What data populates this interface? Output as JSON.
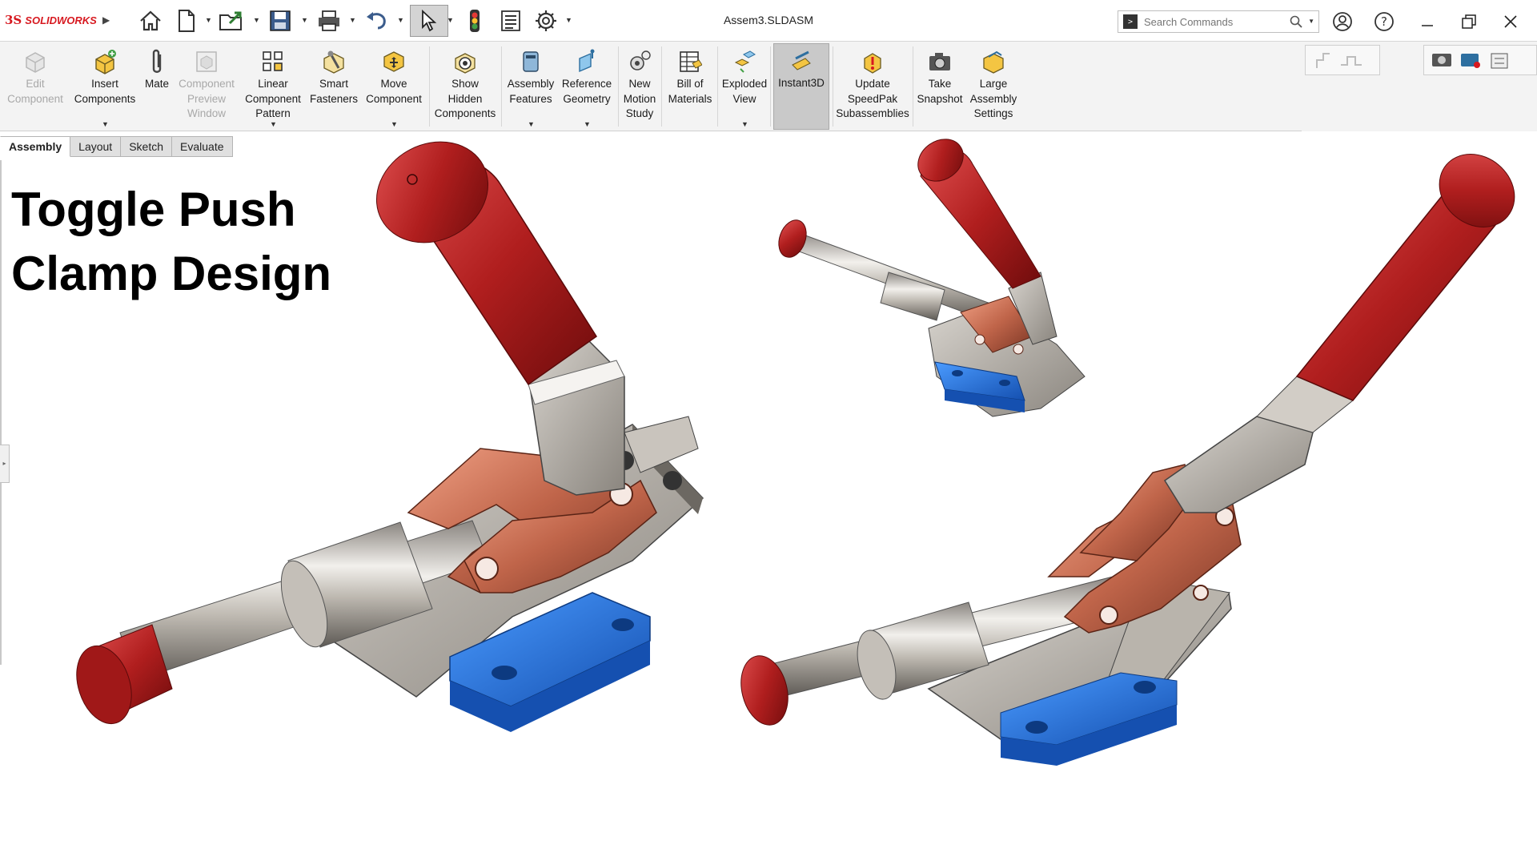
{
  "app": {
    "brand": "SOLIDWORKS",
    "brand_mark": "3S",
    "document_title": "Assem3.SLDASM"
  },
  "search": {
    "placeholder": "Search Commands"
  },
  "colors": {
    "brand_red": "#d71920",
    "handle_red": "#b01e1e",
    "link_copper": "#c0654a",
    "base_blue": "#1e6fd9",
    "steel": "#9c958c"
  },
  "quick_access": [
    "home-icon",
    "new-document-icon",
    "open-icon",
    "save-icon",
    "print-icon",
    "undo-icon",
    "select-icon",
    "rebuild-icon",
    "file-properties-icon",
    "options-icon"
  ],
  "window_buttons": [
    "account-icon",
    "help-icon",
    "minimize-icon",
    "restore-icon",
    "close-icon"
  ],
  "ribbon": {
    "edit_component": "Edit\nComponent",
    "insert_components": "Insert\nComponents",
    "mate": "Mate",
    "component_preview": "Component\nPreview\nWindow",
    "linear_pattern": "Linear\nComponent\nPattern",
    "smart_fasteners": "Smart\nFasteners",
    "move_component": "Move\nComponent",
    "show_hidden": "Show\nHidden\nComponents",
    "assembly_features": "Assembly\nFeatures",
    "reference_geometry": "Reference\nGeometry",
    "new_motion_study": "New\nMotion\nStudy",
    "bill_of_materials": "Bill of\nMaterials",
    "exploded_view": "Exploded\nView",
    "instant3d": "Instant3D",
    "update_speedpak": "Update\nSpeedPak\nSubassemblies",
    "take_snapshot": "Take\nSnapshot",
    "large_assembly": "Large\nAssembly\nSettings"
  },
  "tabs": [
    "Assembly",
    "Layout",
    "Sketch",
    "Evaluate"
  ],
  "viewport": {
    "headline_line1": "Toggle Push",
    "headline_line2": "Clamp Design"
  }
}
